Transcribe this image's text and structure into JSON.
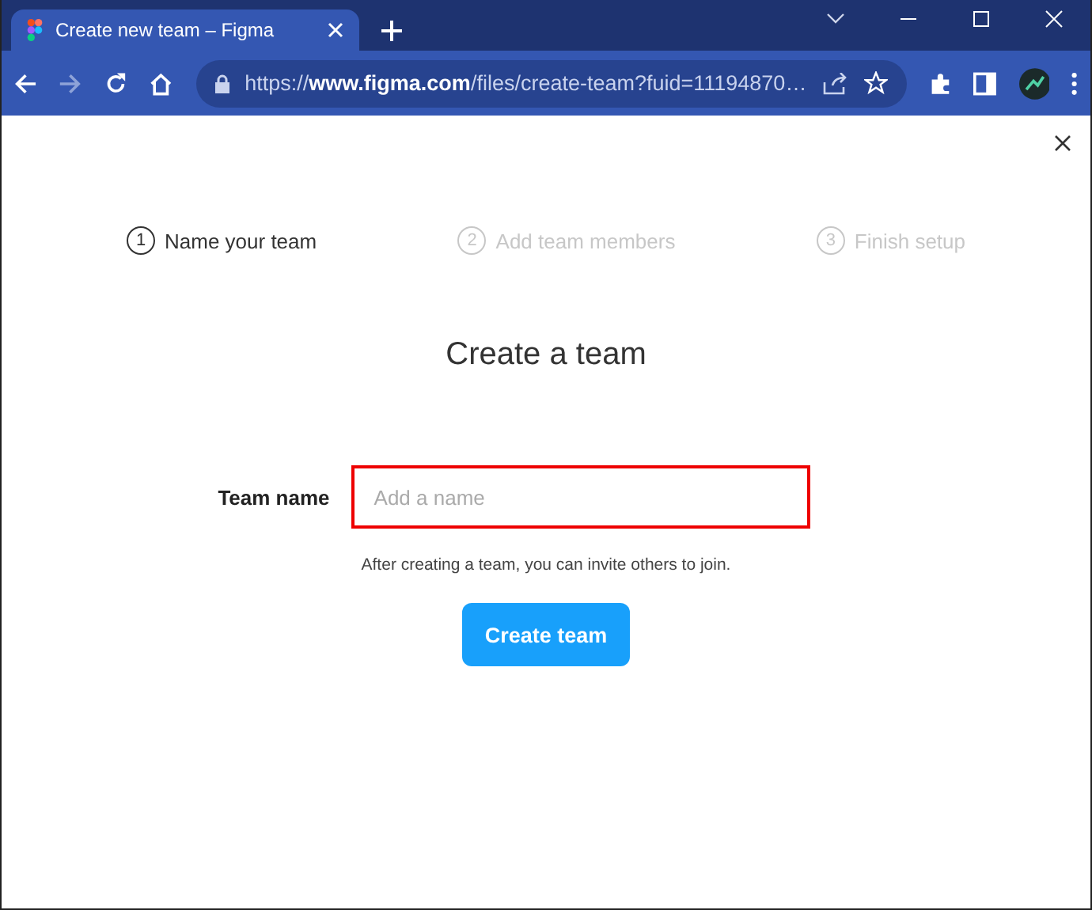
{
  "browser": {
    "tab_title": "Create new team – Figma",
    "url": "https://**www.figma.com**/files/create-team?fuid=11194870…"
  },
  "steps": [
    {
      "number": "1",
      "label": "Name your team",
      "selected": true
    },
    {
      "number": "2",
      "label": "Add team members",
      "selected": false
    },
    {
      "number": "3",
      "label": "Finish setup",
      "selected": false
    }
  ],
  "heading": "Create a team",
  "team_name": {
    "label": "Team name",
    "placeholder": "Add a name",
    "highlighted": true
  },
  "hint": "After creating a team, you can invite others to join.",
  "button": "Create team"
}
